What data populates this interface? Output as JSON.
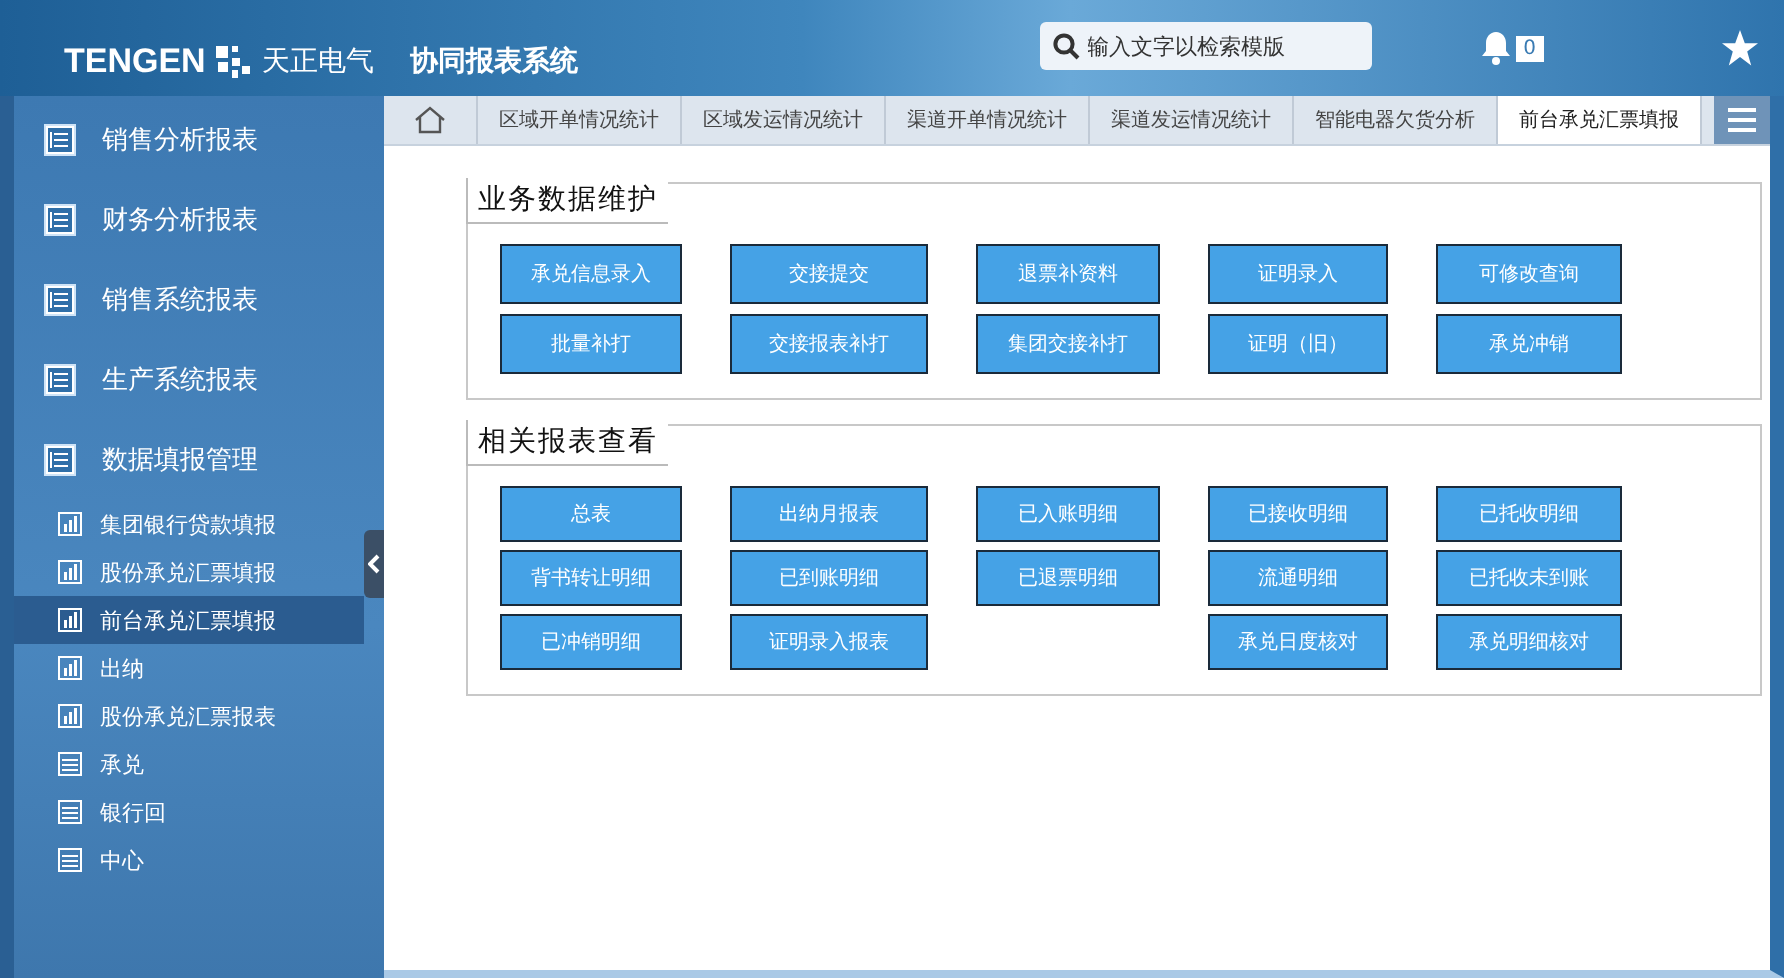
{
  "header": {
    "brand": "TENGEN",
    "company": "天正电气",
    "system": "协同报表系统",
    "search": {
      "placeholder": "输入文字以检索模版"
    },
    "notifications": "0"
  },
  "sidebar": {
    "items": [
      {
        "label": "销售分析报表",
        "kind": "group"
      },
      {
        "label": "财务分析报表",
        "kind": "group"
      },
      {
        "label": "销售系统报表",
        "kind": "group"
      },
      {
        "label": "生产系统报表",
        "kind": "group"
      },
      {
        "label": "数据填报管理",
        "kind": "group"
      },
      {
        "label": "集团银行贷款填报",
        "kind": "chart",
        "selected": false
      },
      {
        "label": "股份承兑汇票填报",
        "kind": "chart",
        "selected": false
      },
      {
        "label": "前台承兑汇票填报",
        "kind": "chart",
        "selected": true
      },
      {
        "label": "出纳",
        "kind": "chart",
        "selected": false
      },
      {
        "label": "股份承兑汇票报表",
        "kind": "chart",
        "selected": false
      },
      {
        "label": "承兑",
        "kind": "table",
        "selected": false
      },
      {
        "label": "银行回",
        "kind": "table",
        "selected": false
      },
      {
        "label": "中心",
        "kind": "table",
        "selected": false
      }
    ]
  },
  "tabs": [
    {
      "label": "区域开单情况统计",
      "selected": false
    },
    {
      "label": "区域发运情况统计",
      "selected": false
    },
    {
      "label": "渠道开单情况统计",
      "selected": false
    },
    {
      "label": "渠道发运情况统计",
      "selected": false
    },
    {
      "label": "智能电器欠货分析",
      "selected": false
    },
    {
      "label": "前台承兑汇票填报",
      "selected": true
    }
  ],
  "sections": [
    {
      "title": "业务数据维护",
      "rows": [
        [
          "承兑信息录入",
          "交接提交",
          "退票补资料",
          "证明录入",
          "可修改查询"
        ],
        [
          "批量补打",
          "交接报表补打",
          "集团交接补打",
          "证明（旧）",
          "承兑冲销"
        ]
      ]
    },
    {
      "title": "相关报表查看",
      "rows": [
        [
          "总表",
          "出纳月报表",
          "已入账明细",
          "已接收明细",
          "已托收明细"
        ],
        [
          "背书转让明细",
          "已到账明细",
          "已退票明细",
          "流通明细",
          "已托收未到账"
        ],
        [
          "已冲销明细",
          "证明录入报表",
          "",
          "承兑日度核对",
          "承兑明细核对"
        ]
      ]
    }
  ]
}
